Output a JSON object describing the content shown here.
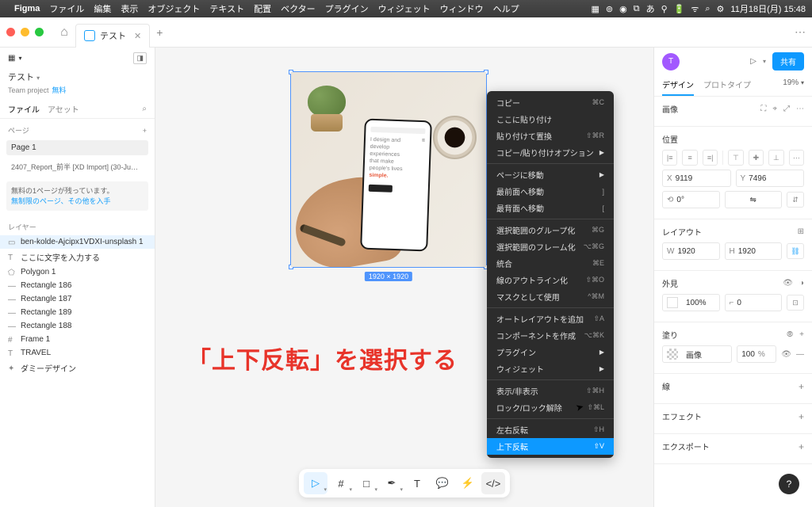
{
  "menubar": {
    "app": "Figma",
    "items": [
      "ファイル",
      "編集",
      "表示",
      "オブジェクト",
      "テキスト",
      "配置",
      "ベクター",
      "プラグイン",
      "ウィジェット",
      "ウィンドウ",
      "ヘルプ"
    ],
    "right": [
      "11月18日(月) 15:48"
    ]
  },
  "tab": {
    "name": "テスト"
  },
  "left": {
    "title": "テスト",
    "team": "Team project",
    "free": "無料",
    "tabs": {
      "file": "ファイル",
      "asset": "アセット"
    },
    "pages_label": "ページ",
    "pages": [
      "Page 1",
      "2407_Report_前半  [XD Import] (30-Ju…"
    ],
    "notice": "無料の1ページが残っています。",
    "notice_link": "無制限のページ、その他を入手",
    "layers_label": "レイヤー",
    "layers": [
      {
        "icon": "▭",
        "name": "ben-kolde-Ajcipx1VDXI-unsplash 1",
        "sel": true
      },
      {
        "icon": "T",
        "name": "ここに文字を入力する"
      },
      {
        "icon": "⬠",
        "name": "Polygon 1"
      },
      {
        "icon": "—",
        "name": "Rectangle 186"
      },
      {
        "icon": "—",
        "name": "Rectangle 187"
      },
      {
        "icon": "—",
        "name": "Rectangle 189"
      },
      {
        "icon": "—",
        "name": "Rectangle 188"
      },
      {
        "icon": "#",
        "name": "Frame 1"
      },
      {
        "icon": "T",
        "name": "TRAVEL"
      },
      {
        "icon": "✦",
        "name": "ダミーデザイン"
      }
    ]
  },
  "canvas": {
    "size_tag": "1920 × 1920",
    "phone_text": {
      "l1": "I design and",
      "l2": "develop",
      "l3": "experiences",
      "l4": "that make",
      "l5": "people's lives",
      "l6": "simple."
    },
    "red_text": "「上下反転」を選択する"
  },
  "ctx": [
    {
      "t": "コピー",
      "s": "⌘C"
    },
    {
      "t": "ここに貼り付け"
    },
    {
      "t": "貼り付けて置換",
      "s": "⇧⌘R"
    },
    {
      "t": "コピー/貼り付けオプション",
      "arr": true
    },
    {
      "sep": true
    },
    {
      "t": "ページに移動",
      "arr": true
    },
    {
      "t": "最前面へ移動",
      "s": "]"
    },
    {
      "t": "最背面へ移動",
      "s": "["
    },
    {
      "sep": true
    },
    {
      "t": "選択範囲のグループ化",
      "s": "⌘G"
    },
    {
      "t": "選択範囲のフレーム化",
      "s": "⌥⌘G"
    },
    {
      "t": "統合",
      "s": "⌘E"
    },
    {
      "t": "線のアウトライン化",
      "s": "⇧⌘O"
    },
    {
      "t": "マスクとして使用",
      "s": "^⌘M"
    },
    {
      "sep": true
    },
    {
      "t": "オートレイアウトを追加",
      "s": "⇧A"
    },
    {
      "t": "コンポーネントを作成",
      "s": "⌥⌘K"
    },
    {
      "t": "プラグイン",
      "arr": true
    },
    {
      "t": "ウィジェット",
      "arr": true
    },
    {
      "sep": true
    },
    {
      "t": "表示/非表示",
      "s": "⇧⌘H"
    },
    {
      "t": "ロック/ロック解除",
      "s": "⇧⌘L"
    },
    {
      "sep": true
    },
    {
      "t": "左右反転",
      "s": "⇧H"
    },
    {
      "t": "上下反転",
      "s": "⇧V",
      "hl": true
    }
  ],
  "right": {
    "avatar": "T",
    "share": "共有",
    "tabs": {
      "design": "デザイン",
      "proto": "プロトタイプ"
    },
    "zoom": "19%",
    "image": {
      "label": "画像"
    },
    "position": {
      "label": "位置",
      "x": "9119",
      "y": "7496",
      "rot": "0°"
    },
    "layout": {
      "label": "レイアウト",
      "w": "1920",
      "h": "1920"
    },
    "appearance": {
      "label": "外見",
      "opacity": "100%",
      "radius": "0"
    },
    "fill": {
      "label": "塗り",
      "type": "画像",
      "pct": "100"
    },
    "stroke": {
      "label": "線"
    },
    "effect": {
      "label": "エフェクト"
    },
    "export": {
      "label": "エクスポート"
    }
  }
}
